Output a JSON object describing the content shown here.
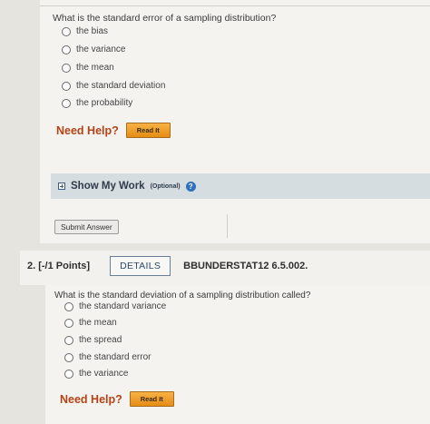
{
  "q1": {
    "question": "What is the standard error of a sampling distribution?",
    "options": [
      "the bias",
      "the variance",
      "the mean",
      "the standard deviation",
      "the probability"
    ],
    "need_help": "Need Help?",
    "read_it": "Read It",
    "show_work": "Show My Work",
    "show_work_optional": "(Optional)",
    "help_glyph": "?",
    "submit": "Submit Answer"
  },
  "q2": {
    "number": "2. [-/1 Points]",
    "details": "DETAILS",
    "code": "BBUNDERSTAT12 6.5.002.",
    "question": "What is the standard deviation of a sampling distribution called?",
    "options": [
      "the standard variance",
      "the mean",
      "the spread",
      "the standard error",
      "the variance"
    ],
    "need_help": "Need Help?",
    "read_it": "Read It"
  },
  "colors": {
    "need_help": "#b34316",
    "read_it": "#f0a030",
    "details_text": "#2c4a6a",
    "show_work_bg": "#d5dde1"
  }
}
